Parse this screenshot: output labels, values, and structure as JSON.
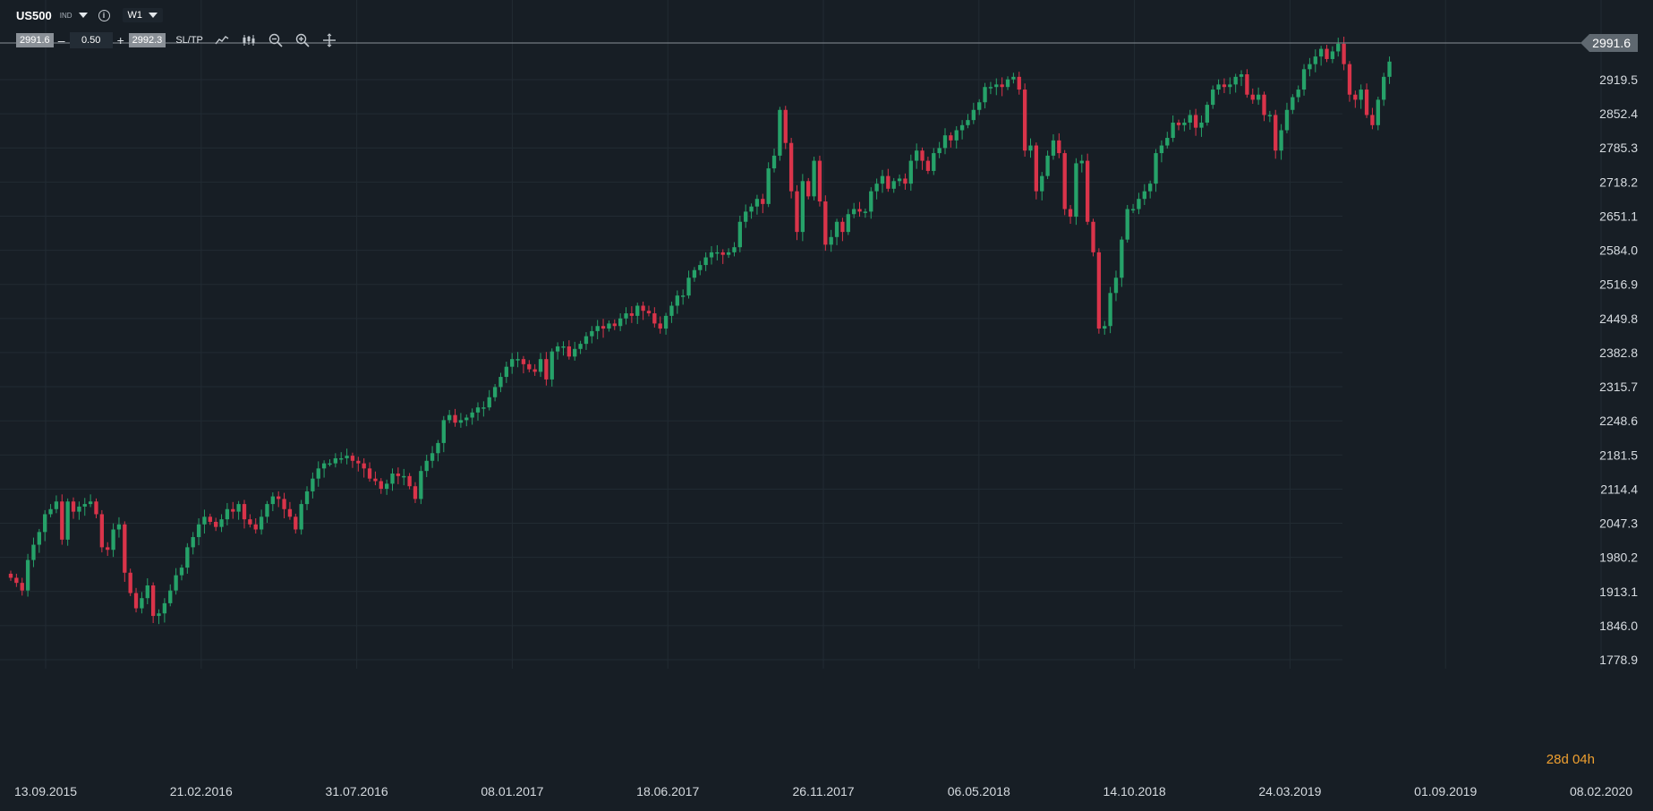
{
  "header": {
    "symbol": "US500",
    "symbol_type": "IND",
    "timeframe": "W1",
    "sell_price": "2991.6",
    "quantity": "0.50",
    "buy_price": "2992.3",
    "sltp_label": "SL/TP",
    "minus_label": "–",
    "plus_label": "+",
    "info_label": "i"
  },
  "icons": {
    "symbol_dropdown": "chevron-down-icon",
    "info": "info-icon",
    "timeframe_dropdown": "chevron-down-icon",
    "line_chart": "line-chart-icon",
    "candles": "candlestick-icon",
    "zoom_out": "zoom-out-icon",
    "zoom_in": "zoom-in-icon",
    "crosshair": "crosshair-icon"
  },
  "countdown": {
    "days": "28",
    "days_unit": "d",
    "hours": "04",
    "hours_unit": "h"
  },
  "colors": {
    "background": "#171e25",
    "up": "#26a269",
    "down": "#d9344a",
    "grid": "#222b33",
    "axis_text": "#d6dbe0",
    "price_line": "#8a9097"
  },
  "chart_data": {
    "type": "candlestick",
    "instrument": "US500",
    "timeframe": "W1",
    "current_price": 2991.6,
    "y_ticks": [
      "2991.6",
      "2919.5",
      "2852.4",
      "2785.3",
      "2718.2",
      "2651.1",
      "2584.0",
      "2516.9",
      "2449.8",
      "2382.8",
      "2315.7",
      "2248.6",
      "2181.5",
      "2114.4",
      "2047.3",
      "1980.2",
      "1913.1",
      "1846.0",
      "1778.9"
    ],
    "ylim": [
      1778.9,
      2991.6
    ],
    "x_ticks": [
      "13.09.2015",
      "21.02.2016",
      "31.07.2016",
      "08.01.2017",
      "18.06.2017",
      "26.11.2017",
      "06.05.2018",
      "14.10.2018",
      "24.03.2019",
      "01.09.2019",
      "08.02.2020"
    ],
    "grid": true,
    "closes": [
      1940,
      1930,
      1915,
      1975,
      2005,
      2030,
      2065,
      2075,
      2090,
      2015,
      2090,
      2070,
      2080,
      2085,
      2090,
      2065,
      2000,
      1995,
      2035,
      2045,
      1950,
      1910,
      1880,
      1900,
      1925,
      1865,
      1870,
      1890,
      1915,
      1945,
      1960,
      2000,
      2020,
      2045,
      2060,
      2050,
      2040,
      2055,
      2075,
      2070,
      2085,
      2055,
      2045,
      2035,
      2060,
      2085,
      2100,
      2095,
      2075,
      2060,
      2035,
      2085,
      2110,
      2135,
      2155,
      2165,
      2165,
      2175,
      2175,
      2180,
      2170,
      2165,
      2155,
      2135,
      2130,
      2115,
      2125,
      2145,
      2140,
      2140,
      2120,
      2095,
      2150,
      2170,
      2185,
      2205,
      2250,
      2260,
      2245,
      2250,
      2255,
      2265,
      2275,
      2275,
      2295,
      2315,
      2335,
      2355,
      2370,
      2370,
      2360,
      2350,
      2345,
      2370,
      2330,
      2385,
      2395,
      2395,
      2375,
      2390,
      2400,
      2415,
      2425,
      2435,
      2430,
      2440,
      2435,
      2450,
      2460,
      2455,
      2475,
      2465,
      2460,
      2440,
      2430,
      2455,
      2475,
      2495,
      2495,
      2530,
      2545,
      2555,
      2570,
      2580,
      2580,
      2575,
      2580,
      2590,
      2640,
      2660,
      2670,
      2685,
      2675,
      2745,
      2770,
      2860,
      2795,
      2700,
      2620,
      2720,
      2690,
      2760,
      2680,
      2595,
      2610,
      2640,
      2620,
      2655,
      2665,
      2660,
      2660,
      2700,
      2715,
      2730,
      2705,
      2720,
      2725,
      2715,
      2760,
      2780,
      2760,
      2740,
      2775,
      2785,
      2810,
      2800,
      2820,
      2830,
      2840,
      2860,
      2875,
      2905,
      2905,
      2910,
      2905,
      2920,
      2925,
      2900,
      2780,
      2790,
      2700,
      2730,
      2770,
      2800,
      2775,
      2665,
      2650,
      2755,
      2760,
      2640,
      2580,
      2430,
      2435,
      2500,
      2530,
      2605,
      2665,
      2665,
      2685,
      2700,
      2715,
      2775,
      2790,
      2805,
      2835,
      2830,
      2835,
      2850,
      2825,
      2835,
      2870,
      2900,
      2910,
      2905,
      2910,
      2925,
      2930,
      2890,
      2880,
      2890,
      2850,
      2850,
      2780,
      2820,
      2860,
      2885,
      2900,
      2940,
      2950,
      2965,
      2980,
      2960,
      2975,
      2990,
      2950,
      2890,
      2880,
      2900,
      2850,
      2830,
      2880,
      2925,
      2955,
      2965,
      2980,
      2975,
      2990
    ]
  }
}
